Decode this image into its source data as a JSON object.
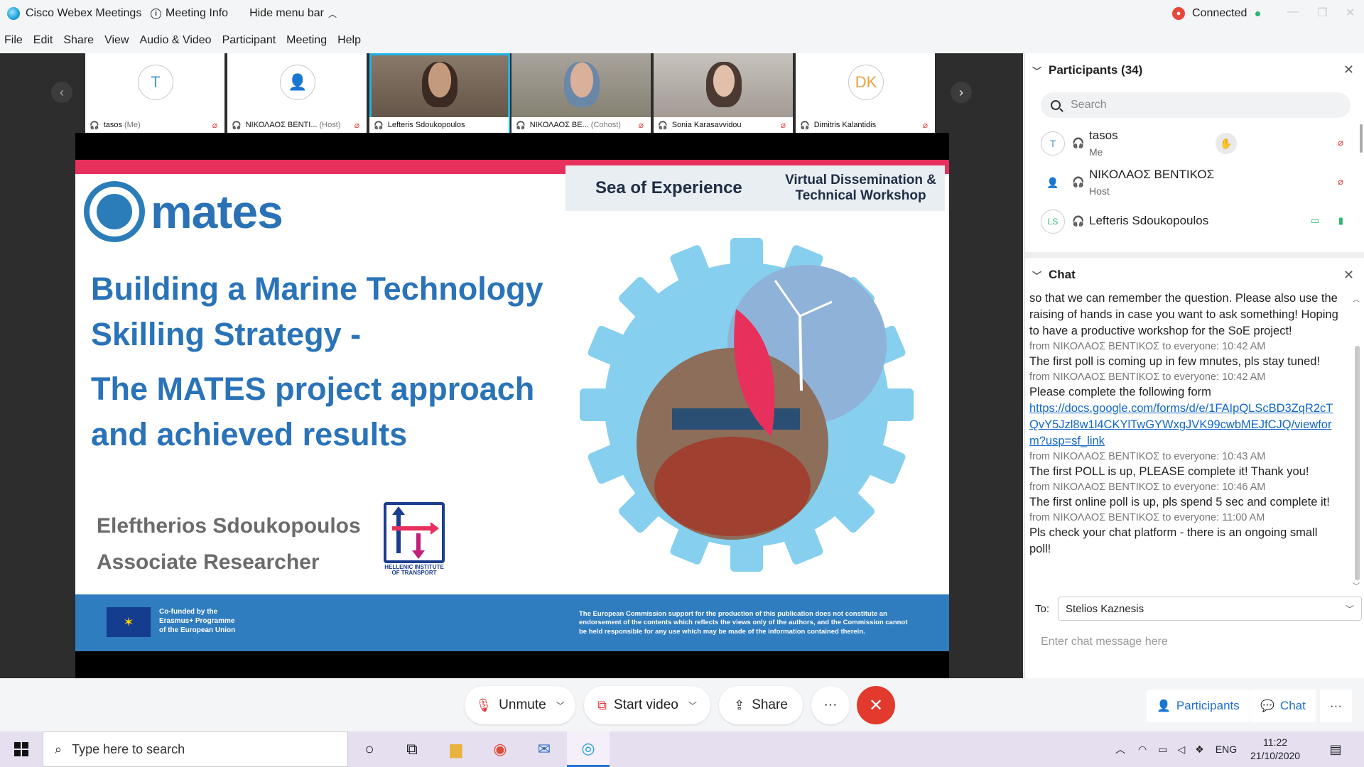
{
  "titlebar": {
    "app_name": "Cisco Webex Meetings",
    "meeting_info": "Meeting Info",
    "hide_menu": "Hide menu bar",
    "status": "Connected"
  },
  "menu": [
    "File",
    "Edit",
    "Share",
    "View",
    "Audio & Video",
    "Participant",
    "Meeting",
    "Help"
  ],
  "strip": {
    "tiles": [
      {
        "avatar": "T",
        "name": "tasos",
        "sub": "(Me)"
      },
      {
        "avatar": "",
        "name": "ΝΙΚΟΛΑΟΣ ΒΕΝΤΙ...",
        "sub": "(Host)"
      },
      {
        "avatar": "",
        "name": "Lefteris Sdoukopoulos",
        "sub": ""
      },
      {
        "avatar": "",
        "name": "ΝΙΚΟΛΑΟΣ ΒΕ...",
        "sub": "(Cohost)"
      },
      {
        "avatar": "",
        "name": "Sonia Karasavvidou",
        "sub": ""
      },
      {
        "avatar": "DK",
        "name": "Dimitris Kalantidis",
        "sub": ""
      }
    ]
  },
  "slide": {
    "logo_word": "mates",
    "banner_left": "Sea of Experience",
    "banner_right_1": "Virtual Dissemination &",
    "banner_right_2": "Technical Workshop",
    "title_1": "Building a Marine Technology",
    "title_2": "Skilling Strategy -",
    "title_3": "The MATES project approach",
    "title_4": "and achieved results",
    "presenter_name": "Eleftherios Sdoukopoulos",
    "presenter_role": "Associate Researcher",
    "hit_caption_1": "HELLENIC INSTITUTE",
    "hit_caption_2": "OF TRANSPORT",
    "cofund_1": "Co-funded by the",
    "cofund_2": "Erasmus+ Programme",
    "cofund_3": "of the European Union",
    "disclaimer": "The European Commission support for the production of this publication does not constitute an endorsement of the contents which reflects the views only of the authors, and the Commission cannot be held responsible for any use which may be made of the information contained therein."
  },
  "participants": {
    "header": "Participants (34)",
    "search_placeholder": "Search",
    "list": [
      {
        "avatar": "T",
        "name": "tasos",
        "role": "Me"
      },
      {
        "avatar": "",
        "name": "ΝΙΚΟΛΑΟΣ ΒΕΝΤΙΚΟΣ",
        "role": "Host"
      },
      {
        "avatar": "LS",
        "name": "Lefteris Sdoukopoulos",
        "role": ""
      }
    ]
  },
  "chat": {
    "header": "Chat",
    "messages": [
      {
        "meta": "",
        "text": "so that we can remember the question. Please also use the raising of hands in case you want to ask something! Hoping to have a productive workshop for the SoE project!"
      },
      {
        "meta": "from ΝΙΚΟΛΑΟΣ ΒΕΝΤΙΚΟΣ to everyone:    10:42 AM",
        "text": "The first poll is coming up in few mnutes, pls stay tuned!"
      },
      {
        "meta": "from ΝΙΚΟΛΑΟΣ ΒΕΝΤΙΚΟΣ to everyone:    10:42 AM",
        "text": "Please complete the following form"
      },
      {
        "meta": "from ΝΙΚΟΛΑΟΣ ΒΕΝΤΙΚΟΣ to everyone:    10:43 AM",
        "text": "The first POLL is up, PLEASE complete it! Thank you!"
      },
      {
        "meta": "from ΝΙΚΟΛΑΟΣ ΒΕΝΤΙΚΟΣ to everyone:    10:46 AM",
        "text": "The first online poll is up, pls spend 5 sec and complete it!"
      },
      {
        "meta": "from ΝΙΚΟΛΑΟΣ ΒΕΝΤΙΚΟΣ to everyone:    11:00 AM",
        "text": "Pls check your chat platform - there is an ongoing small poll!"
      }
    ],
    "link": "https://docs.google.com/forms/d/e/1FAIpQLScBD3ZqR2cTQvY5Jzl8w1l4CKYlTwGYWxgJVK99cwbMEJfCJQ/viewform?usp=sf_link",
    "to_label": "To:",
    "to_value": "Stelios Kaznesis",
    "input_placeholder": "Enter chat message here"
  },
  "controls": {
    "unmute": "Unmute",
    "start_video": "Start video",
    "share": "Share",
    "more": "···",
    "participants": "Participants",
    "chat": "Chat"
  },
  "taskbar": {
    "search_placeholder": "Type here to search",
    "lang": "ENG",
    "time": "11:22",
    "date": "21/10/2020"
  },
  "colors": {
    "accent": "#1fb2e8",
    "end_call": "#e23a2c",
    "mates_blue": "#2a73b8",
    "slide_stripe": "#e8305c",
    "link": "#1166cc"
  }
}
